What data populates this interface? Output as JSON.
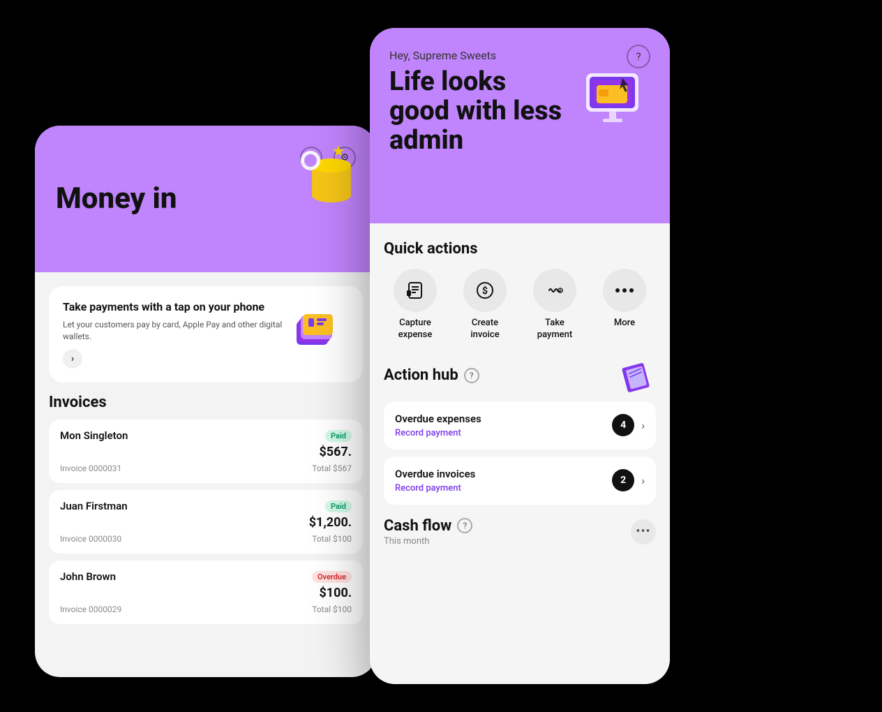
{
  "scene": {
    "background": "#000"
  },
  "cardBack": {
    "header": {
      "title": "Money in",
      "iconHelp": "?",
      "iconSettings": "⚙"
    },
    "promoCard": {
      "title": "Take payments with a tap on your phone",
      "description": "Let your customers pay by card, Apple Pay and other digital wallets.",
      "arrowLabel": "›"
    },
    "invoices": {
      "sectionTitle": "Invoices",
      "items": [
        {
          "name": "Mon Singleton",
          "badge": "Pa...",
          "badgeType": "paid",
          "amount": "$567.",
          "invoiceNumber": "Invoice 0000031",
          "total": "Total $567"
        },
        {
          "name": "Juan Firstman",
          "badge": "Pa...",
          "badgeType": "paid",
          "amount": "$1,200.",
          "invoiceNumber": "Invoice 0000030",
          "total": "Total $100"
        },
        {
          "name": "John Brown",
          "badge": "Overdu...",
          "badgeType": "overdue",
          "amount": "$100.",
          "invoiceNumber": "Invoice 0000029",
          "total": "Total $100"
        }
      ]
    }
  },
  "cardFront": {
    "header": {
      "greeting": "Hey, Supreme Sweets",
      "headline": "Life looks good with less admin",
      "helpIcon": "?"
    },
    "quickActions": {
      "title": "Quick actions",
      "items": [
        {
          "icon": "📋",
          "label": "Capture\nexpense",
          "iconName": "capture-expense-icon"
        },
        {
          "icon": "💰",
          "label": "Create\ninvoice",
          "iconName": "create-invoice-icon"
        },
        {
          "icon": "📶",
          "label": "Take\npayment",
          "iconName": "take-payment-icon"
        },
        {
          "icon": "•••",
          "label": "More",
          "iconName": "more-icon"
        }
      ]
    },
    "actionHub": {
      "title": "Action hub",
      "helpIcon": "?",
      "items": [
        {
          "title": "Overdue expenses",
          "link": "Record payment",
          "count": "4"
        },
        {
          "title": "Overdue invoices",
          "link": "Record payment",
          "count": "2"
        }
      ]
    },
    "cashFlow": {
      "title": "Cash flow",
      "helpIcon": "?",
      "subtitle": "This month",
      "moreIcon": "•••"
    }
  }
}
